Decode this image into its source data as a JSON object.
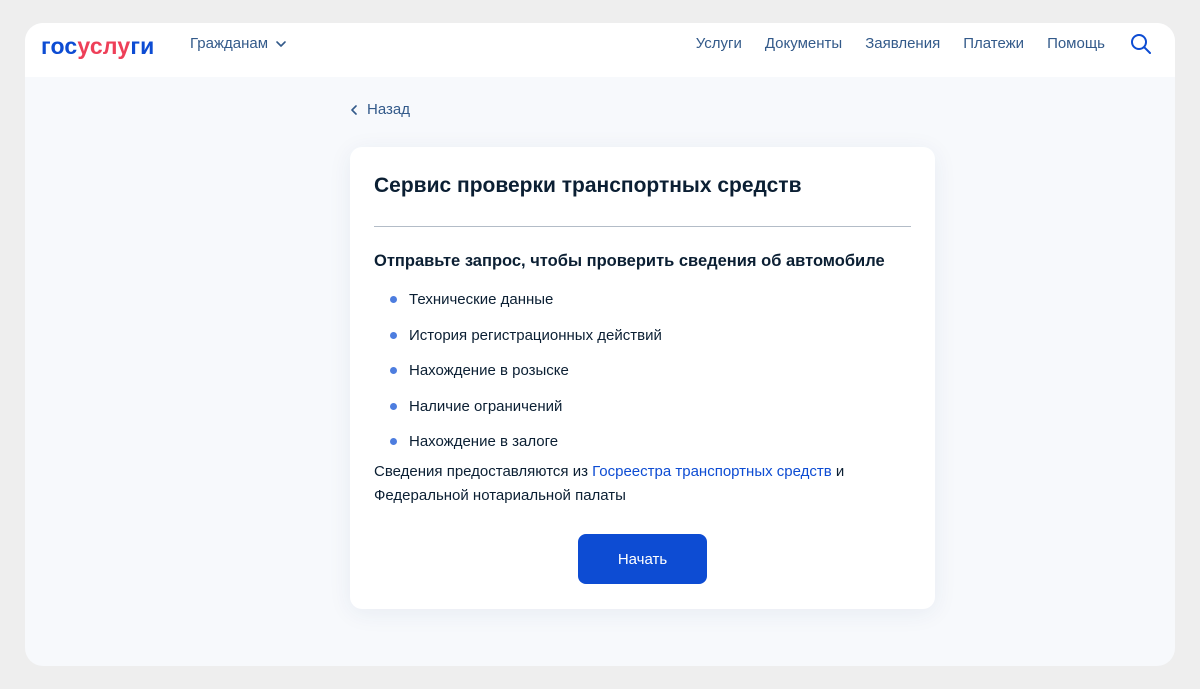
{
  "header": {
    "logo": {
      "part1": "гос",
      "part2": "услу",
      "part3": "ги"
    },
    "audience_selector": "Гражданам",
    "nav": [
      {
        "label": "Услуги"
      },
      {
        "label": "Документы"
      },
      {
        "label": "Заявления"
      },
      {
        "label": "Платежи"
      },
      {
        "label": "Помощь"
      }
    ],
    "search_icon": "search-icon"
  },
  "back_link": "Назад",
  "card": {
    "title": "Сервис проверки транспортных средств",
    "subtitle": "Отправьте запрос, чтобы проверить сведения об автомобиле",
    "features": [
      "Технические данные",
      "История регистрационных действий",
      "Нахождение в розыске",
      "Наличие ограничений",
      "Нахождение в залоге"
    ],
    "source": {
      "prefix": "Сведения предоставляются из ",
      "link": "Госреестра транспортных средств",
      "suffix": " и Федеральной нотариальной палаты"
    },
    "start_button": "Начать"
  },
  "colors": {
    "brand_blue": "#0d4cd3",
    "brand_red": "#ee3f58",
    "link_blue": "#335a8a",
    "bullet": "#4d7ddf"
  }
}
